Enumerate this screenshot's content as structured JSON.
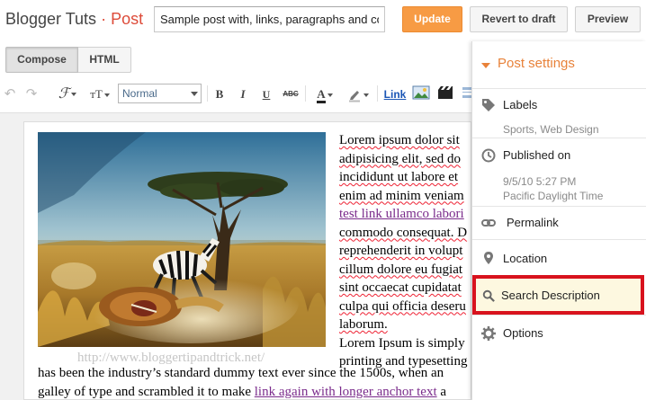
{
  "header": {
    "blog_name": "Blogger Tuts",
    "separator": "·",
    "section": "Post",
    "title_value": "Sample post with, links, paragraphs and co",
    "update_label": "Update",
    "revert_label": "Revert to draft",
    "preview_label": "Preview"
  },
  "tabs": {
    "compose": "Compose",
    "html": "HTML"
  },
  "toolbar": {
    "undo_icon": "↶",
    "redo_icon": "↷",
    "font_icon": "ℱ",
    "size_icon": "тT",
    "format_value": "Normal",
    "bold": "B",
    "italic": "I",
    "underline": "U",
    "strike": "ABC",
    "textcolor": "A",
    "link": "Link"
  },
  "editor": {
    "caption": "http://www.bloggertipandtrick.net/",
    "lines": [
      "Lorem ipsum dolor sit",
      "adipisicing elit, sed do",
      "incididunt ut labore et",
      "enim ad minim veniam",
      "test link ullamco labori",
      "commodo consequat. D",
      "reprehenderit in volupt",
      "cillum dolore eu fugiat",
      "sint occaecat cupidatat",
      "culpa qui officia deseru",
      "laborum.",
      "Lorem Ipsum is simply",
      "printing and typesetting"
    ],
    "full_line_1": "has been the industry’s standard dummy text ever since the 1500s, when an",
    "full_line_2_pre": "galley of type and scrambled it to make ",
    "full_line_2_link": "link again with longer anchor text",
    "full_line_2_post": " a"
  },
  "sidebar": {
    "heading": "Post settings",
    "labels": {
      "title": "Labels",
      "value": "Sports, Web Design"
    },
    "published": {
      "title": "Published on",
      "date": "9/5/10 5:27 PM",
      "timezone": "Pacific Daylight Time"
    },
    "permalink": "Permalink",
    "location": "Location",
    "search_description": "Search Description",
    "options": "Options"
  },
  "colors": {
    "accent": "#dd4b39",
    "update": "#f79b44",
    "settings": "#e8823a",
    "highlight_border": "#d8121d"
  }
}
